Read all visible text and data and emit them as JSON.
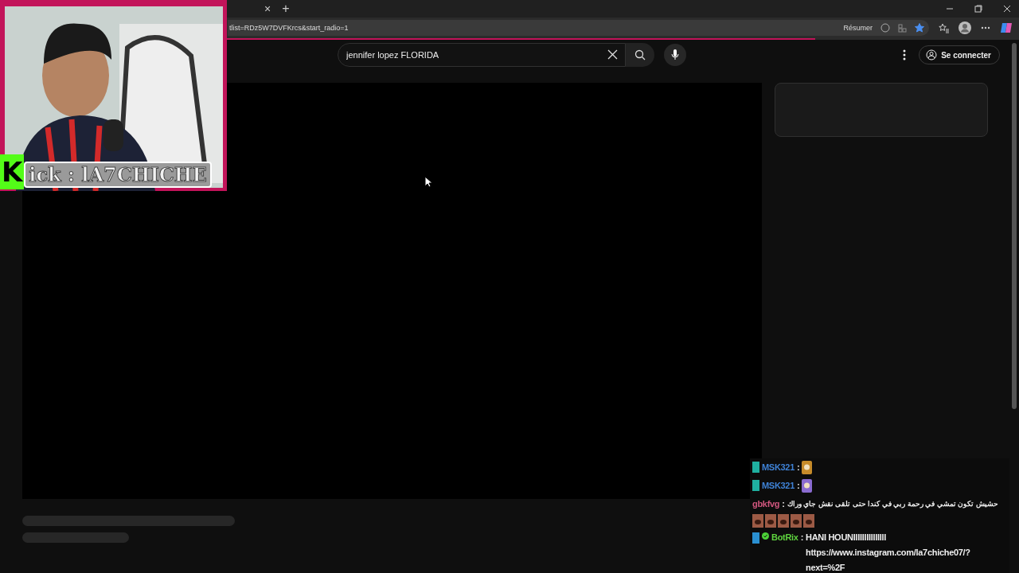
{
  "browser": {
    "tab_close": "×",
    "new_tab": "+",
    "address": "tlist=RDz5W7DVFKrcs&start_radio=1",
    "resume": "Résumer",
    "favorite_on": true
  },
  "site": {
    "search": {
      "value": "jennifer lopez FLORIDA"
    },
    "sign_in": "Se connecter"
  },
  "overlay": {
    "kick_logo": "K",
    "kick_handle": "ick : lA7CHICHE"
  },
  "chat": [
    {
      "kind": "emote",
      "user": "MSK321",
      "color": "#3f82d6",
      "separator": ":"
    },
    {
      "kind": "emote",
      "user": "MSK321",
      "color": "#3f82d6",
      "separator": ":"
    },
    {
      "kind": "text_emotes",
      "user": "gbkfvg",
      "color": "#d0567e",
      "separator": ":",
      "text": "حشيش تكون تمشي في رحمة ربي في كندا حتى تلقى نقش جاي وراك"
    },
    {
      "kind": "bot",
      "user": "BotRix",
      "color": "#5fd33f",
      "separator": ":",
      "text": "HANI HOUNIIIIIIIIIIIIIII https://www.instagram.com/la7chiche07/?next=%2F"
    }
  ]
}
